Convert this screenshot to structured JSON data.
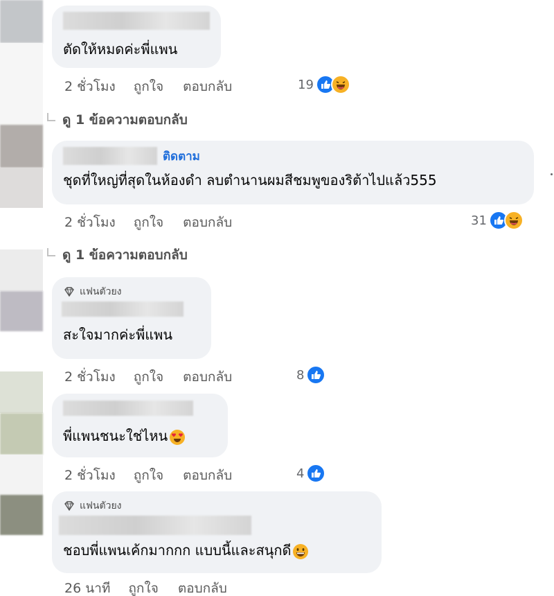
{
  "labels": {
    "like": "ถูกใจ",
    "reply": "ตอบกลับ",
    "view_replies": "ดู 1 ข้อความตอบกลับ",
    "follow": "ติดตาม",
    "fan_badge": "แฟนตัวยง"
  },
  "comments": [
    {
      "text": "ตัดให้หมดค่ะพี่แพน",
      "time": "2 ชั่วโมง",
      "count": "19",
      "reactions": [
        "like-icon",
        "haha-icon"
      ],
      "view_replies": "ดู 1 ข้อความตอบกลับ"
    },
    {
      "follow": "ติดตาม",
      "text": "ชุดที่ใหญ่ที่สุดในห้องดำ ลบตำนานผมสีชมพูของริต้าไปแล้ว555",
      "time": "2 ชั่วโมง",
      "count": "31",
      "reactions": [
        "like-icon",
        "haha-icon"
      ],
      "view_replies": "ดู 1 ข้อความตอบกลับ"
    },
    {
      "badge": "แฟนตัวยง",
      "text": "สะใจมากค่ะพี่แพน",
      "time": "2 ชั่วโมง",
      "count": "8",
      "reactions": [
        "like-icon"
      ]
    },
    {
      "text": "พี่แพนชนะใช่ไหน",
      "emoji": "heart-eyes-emoji",
      "time": "2 ชั่วโมง",
      "count": "4",
      "reactions": [
        "like-icon"
      ]
    },
    {
      "badge": "แฟนตัวยง",
      "text": "ชอบพี่แพนเค้กมากกก แบบนี้และสนุกดี",
      "emoji": "grinning-emoji",
      "time": "26 นาที"
    }
  ],
  "colors": {
    "bubble": "#f0f2f5",
    "like_blue": "#1877f2",
    "follow_blue": "#216fdb",
    "haha_yellow": "#f7b125"
  }
}
